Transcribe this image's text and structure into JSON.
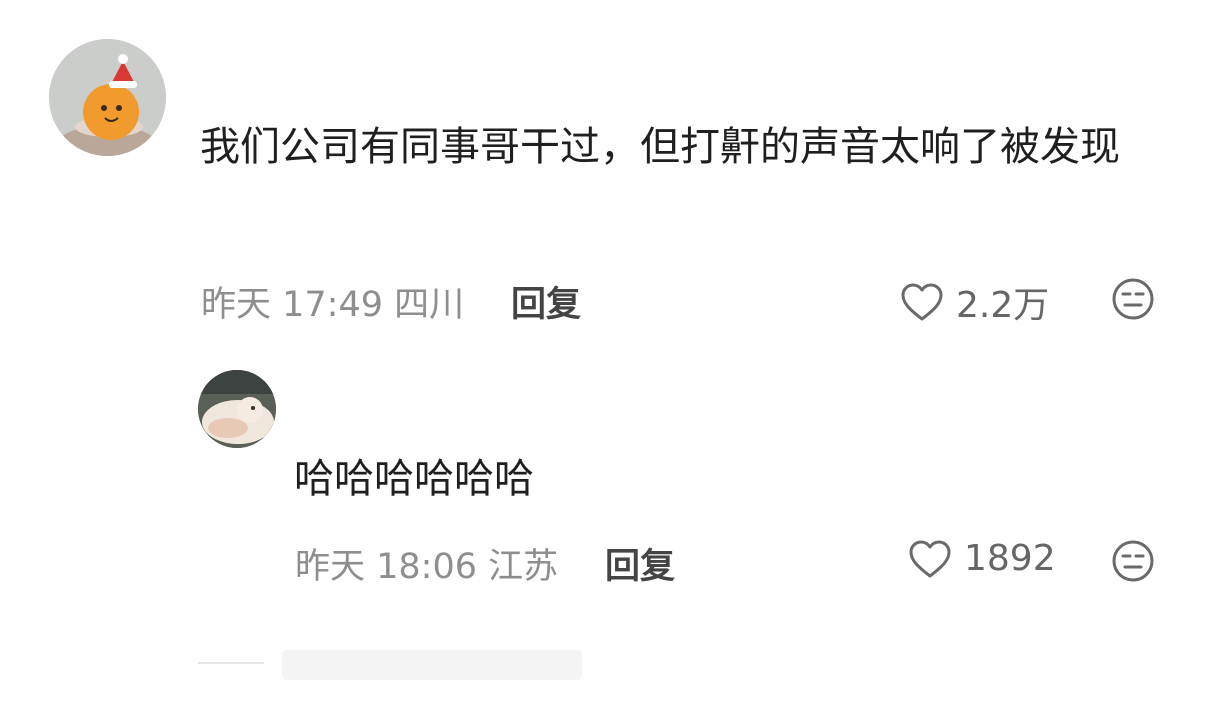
{
  "comments": [
    {
      "text": "我们公司有同事哥干过，但打鼾的声音太响了被发现",
      "meta": "昨天 17:49 四川",
      "reply_label": "回复",
      "likes": "2.2万"
    },
    {
      "text": "哈哈哈哈哈哈",
      "meta": "昨天 18:06 江苏",
      "reply_label": "回复",
      "likes": "1892"
    }
  ]
}
